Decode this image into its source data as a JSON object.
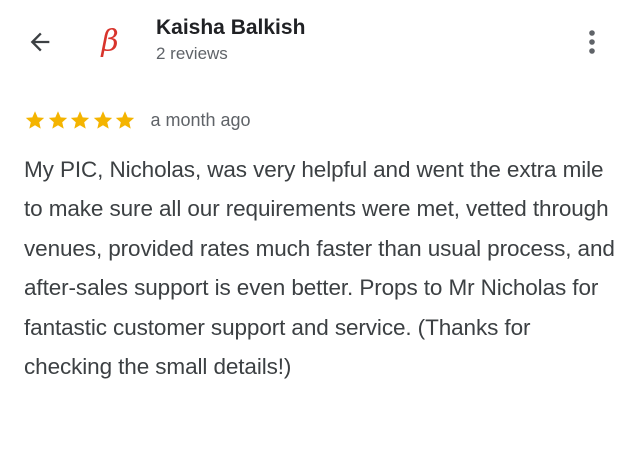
{
  "header": {
    "back_icon": "arrow-back-icon",
    "avatar_glyph": "β",
    "avatar_color": "#d8342c",
    "reviewer_name": "Kaisha Balkish",
    "review_count": "2 reviews",
    "more_icon": "more-vert-icon"
  },
  "review": {
    "rating": 5,
    "rating_max": 5,
    "star_color": "#f4b400",
    "date": "a month ago",
    "text": "My PIC, Nicholas, was very helpful and went the extra mile to make sure all our requirements were met, vetted through venues, provided rates much faster than usual process, and after-sales support is even better. Props to Mr Nicholas for fantastic customer support and service. (Thanks for checking the small details!)"
  }
}
